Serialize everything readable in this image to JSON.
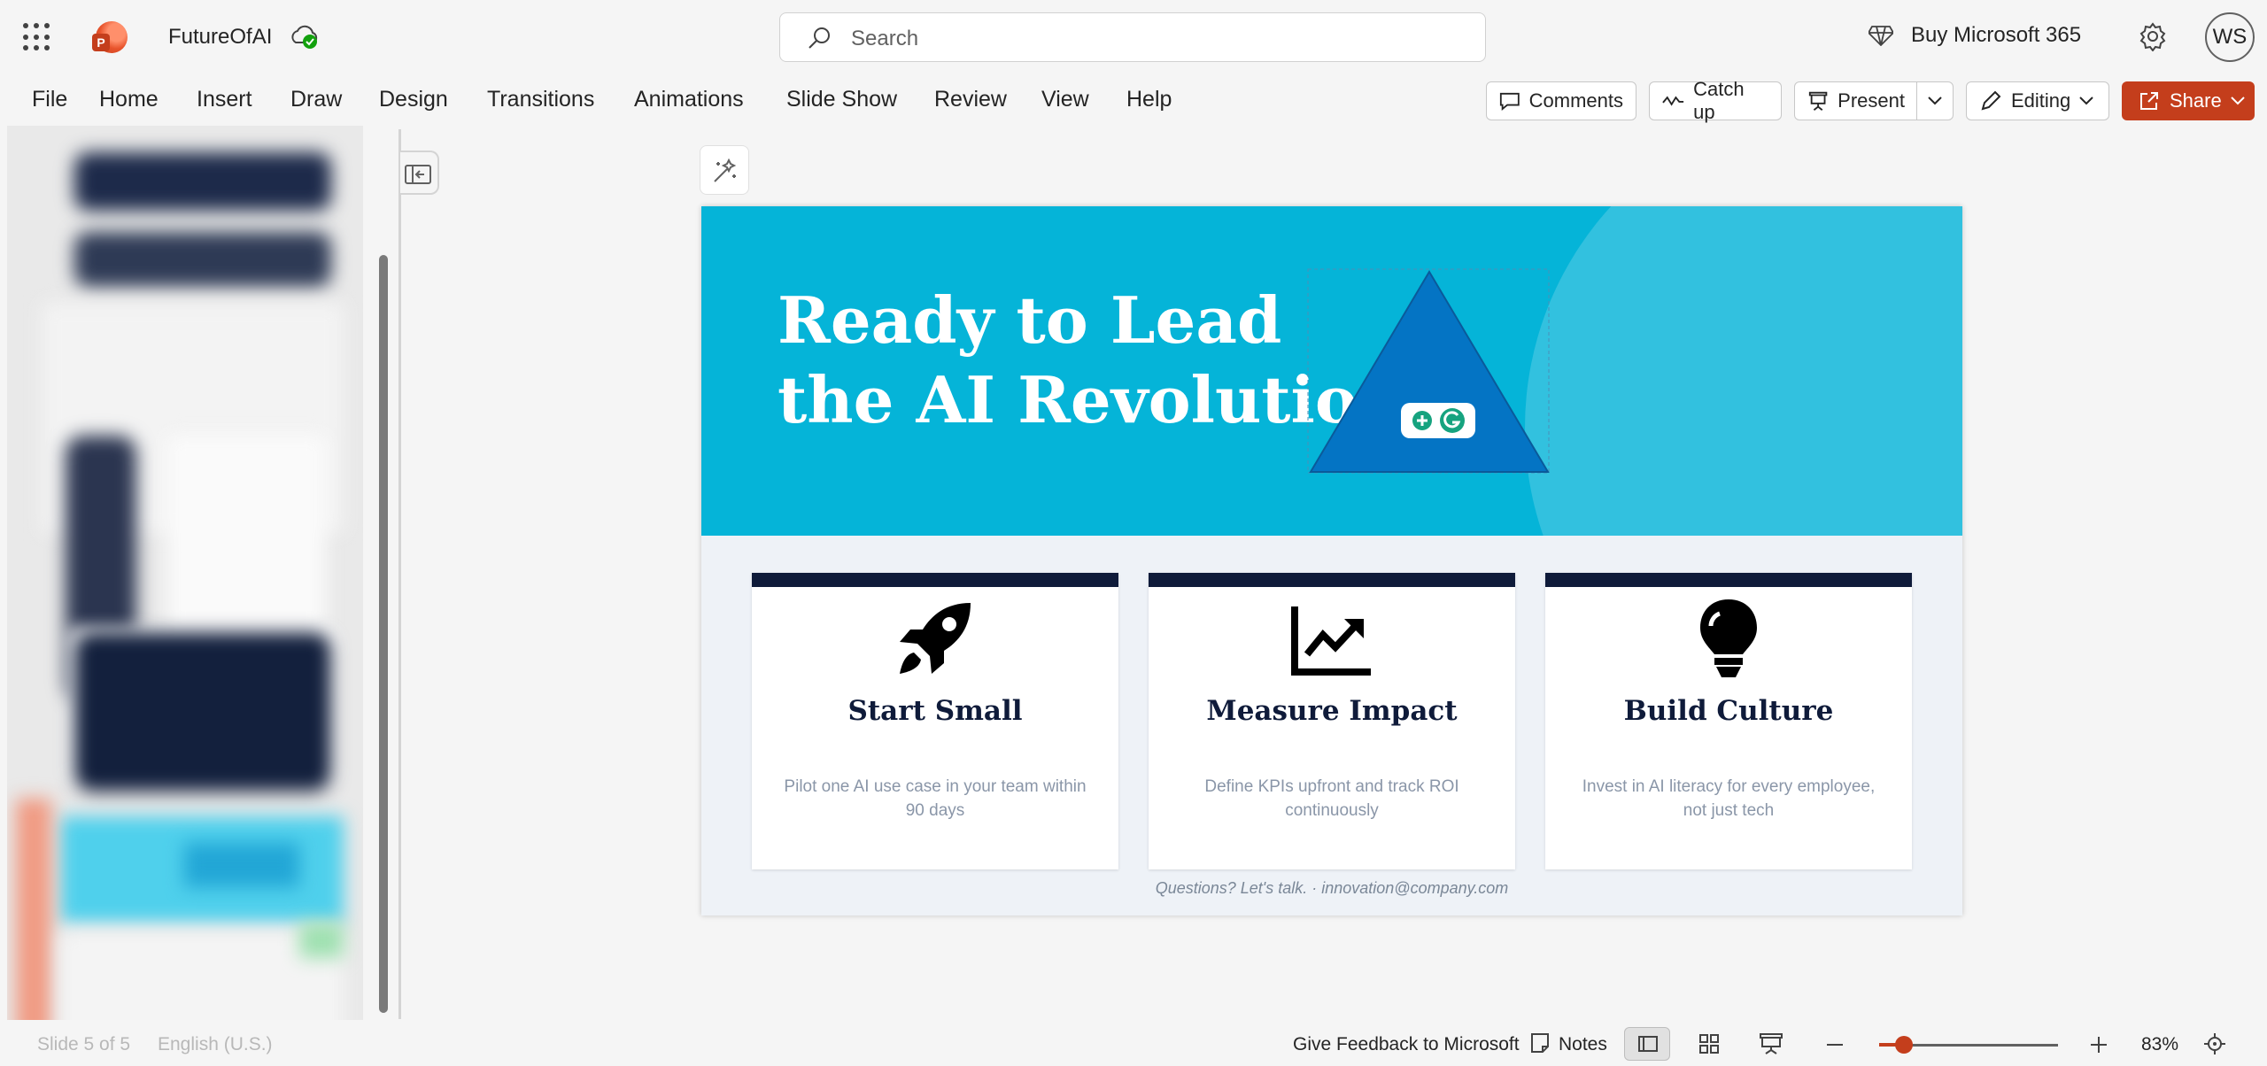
{
  "app": {
    "doc_title": "FutureOfAI",
    "search_placeholder": "Search",
    "buy_label": "Buy Microsoft 365",
    "avatar_initials": "WS",
    "brand_color": "#c43e1c"
  },
  "menu": [
    "File",
    "Home",
    "Insert",
    "Draw",
    "Design",
    "Transitions",
    "Animations",
    "Slide Show",
    "Review",
    "View",
    "Help"
  ],
  "toolbar": {
    "comments": "Comments",
    "catchup": "Catch up",
    "present": "Present",
    "editing": "Editing",
    "share": "Share"
  },
  "slide": {
    "title_line1": "Ready to Lead",
    "title_line2": "the AI Revolution",
    "hero_color": "#05b4d8",
    "cards": [
      {
        "icon": "rocket-icon",
        "title": "Start Small",
        "desc": "Pilot one AI use case in your team within 90 days"
      },
      {
        "icon": "chart-line-icon",
        "title": "Measure Impact",
        "desc": "Define KPIs upfront and track ROI continuously"
      },
      {
        "icon": "lightbulb-icon",
        "title": "Build Culture",
        "desc": "Invest in AI literacy for every employee, not just tech"
      }
    ],
    "footer": "Questions? Let's talk. · innovation@company.com"
  },
  "status": {
    "slide_count": "Slide 5 of 5",
    "language": "English (U.S.)",
    "feedback": "Give Feedback to Microsoft",
    "notes": "Notes",
    "zoom": "83%",
    "zoom_level": 0.14
  }
}
